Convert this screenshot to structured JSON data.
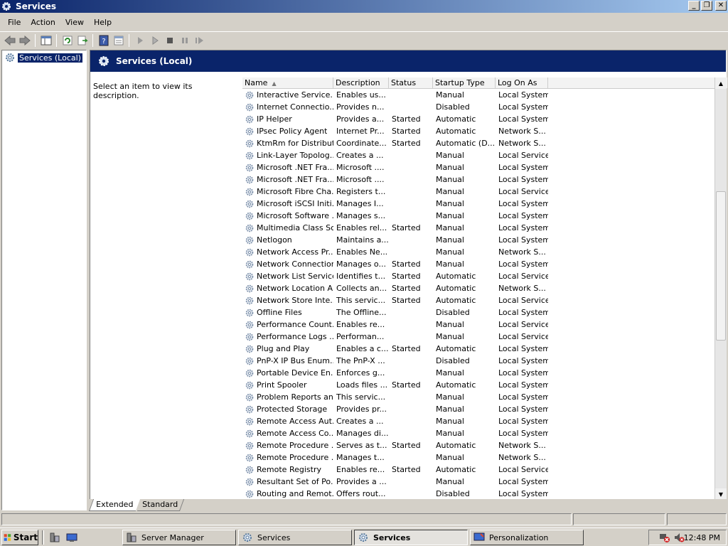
{
  "window": {
    "title": "Services"
  },
  "menu": [
    "File",
    "Action",
    "View",
    "Help"
  ],
  "tree": {
    "selected": "Services (Local)"
  },
  "pane": {
    "title": "Services (Local)",
    "description": "Select an item to view its description."
  },
  "columns": {
    "name": "Name",
    "description": "Description",
    "status": "Status",
    "startup": "Startup Type",
    "logon": "Log On As"
  },
  "services": [
    [
      "Interactive Service...",
      "Enables us...",
      "",
      "Manual",
      "Local System"
    ],
    [
      "Internet Connectio...",
      "Provides n...",
      "",
      "Disabled",
      "Local System"
    ],
    [
      "IP Helper",
      "Provides a...",
      "Started",
      "Automatic",
      "Local System"
    ],
    [
      "IPsec Policy Agent",
      "Internet Pr...",
      "Started",
      "Automatic",
      "Network S..."
    ],
    [
      "KtmRm for Distribut...",
      "Coordinate...",
      "Started",
      "Automatic (D...",
      "Network S..."
    ],
    [
      "Link-Layer Topolog...",
      "Creates a ...",
      "",
      "Manual",
      "Local Service"
    ],
    [
      "Microsoft .NET Fra...",
      "Microsoft ....",
      "",
      "Manual",
      "Local System"
    ],
    [
      "Microsoft .NET Fra...",
      "Microsoft ....",
      "",
      "Manual",
      "Local System"
    ],
    [
      "Microsoft Fibre Cha...",
      "Registers t...",
      "",
      "Manual",
      "Local Service"
    ],
    [
      "Microsoft iSCSI Initi...",
      "Manages I...",
      "",
      "Manual",
      "Local System"
    ],
    [
      "Microsoft Software ...",
      "Manages s...",
      "",
      "Manual",
      "Local System"
    ],
    [
      "Multimedia Class Sc...",
      "Enables rel...",
      "Started",
      "Manual",
      "Local System"
    ],
    [
      "Netlogon",
      "Maintains a...",
      "",
      "Manual",
      "Local System"
    ],
    [
      "Network Access Pr...",
      "Enables Ne...",
      "",
      "Manual",
      "Network S..."
    ],
    [
      "Network Connections",
      "Manages o...",
      "Started",
      "Manual",
      "Local System"
    ],
    [
      "Network List Service",
      "Identifies t...",
      "Started",
      "Automatic",
      "Local Service"
    ],
    [
      "Network Location A...",
      "Collects an...",
      "Started",
      "Automatic",
      "Network S..."
    ],
    [
      "Network Store Inte...",
      "This servic...",
      "Started",
      "Automatic",
      "Local Service"
    ],
    [
      "Offline Files",
      "The Offline...",
      "",
      "Disabled",
      "Local System"
    ],
    [
      "Performance Count...",
      "Enables re...",
      "",
      "Manual",
      "Local Service"
    ],
    [
      "Performance Logs ...",
      "Performan...",
      "",
      "Manual",
      "Local Service"
    ],
    [
      "Plug and Play",
      "Enables a c...",
      "Started",
      "Automatic",
      "Local System"
    ],
    [
      "PnP-X IP Bus Enum...",
      "The PnP-X ...",
      "",
      "Disabled",
      "Local System"
    ],
    [
      "Portable Device En...",
      "Enforces g...",
      "",
      "Manual",
      "Local System"
    ],
    [
      "Print Spooler",
      "Loads files ...",
      "Started",
      "Automatic",
      "Local System"
    ],
    [
      "Problem Reports an...",
      "This servic...",
      "",
      "Manual",
      "Local System"
    ],
    [
      "Protected Storage",
      "Provides pr...",
      "",
      "Manual",
      "Local System"
    ],
    [
      "Remote Access Aut...",
      "Creates a ...",
      "",
      "Manual",
      "Local System"
    ],
    [
      "Remote Access Co...",
      "Manages di...",
      "",
      "Manual",
      "Local System"
    ],
    [
      "Remote Procedure ...",
      "Serves as t...",
      "Started",
      "Automatic",
      "Network S..."
    ],
    [
      "Remote Procedure ...",
      "Manages t...",
      "",
      "Manual",
      "Network S..."
    ],
    [
      "Remote Registry",
      "Enables re...",
      "Started",
      "Automatic",
      "Local Service"
    ],
    [
      "Resultant Set of Po...",
      "Provides a ...",
      "",
      "Manual",
      "Local System"
    ],
    [
      "Routing and Remot...",
      "Offers rout...",
      "",
      "Disabled",
      "Local System"
    ]
  ],
  "tabs": {
    "extended": "Extended",
    "standard": "Standard"
  },
  "taskbar": {
    "start": "Start",
    "tasks": [
      "Server Manager",
      "Services",
      "Services",
      "Personalization"
    ],
    "clock": "12:48 PM"
  },
  "colors": {
    "title_bar": "#0a246a",
    "pane_header": "#0a246a",
    "chrome": "#d4d0c8"
  }
}
